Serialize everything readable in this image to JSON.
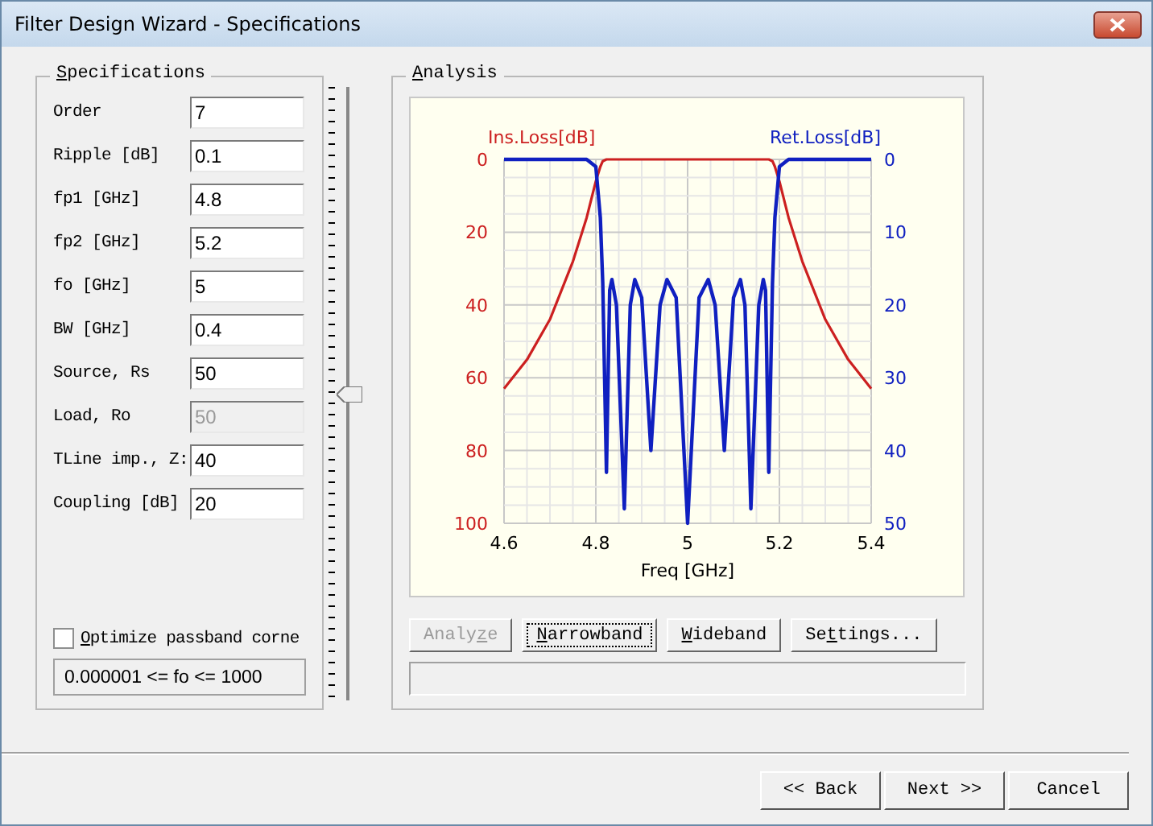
{
  "window": {
    "title": "Filter Design Wizard - Specifications"
  },
  "specifications": {
    "title": {
      "accel": "S",
      "rest": "pecifications"
    },
    "fields": [
      {
        "label": "Order",
        "value": "7",
        "disabled": false
      },
      {
        "label": "Ripple [dB]",
        "value": "0.1",
        "disabled": false
      },
      {
        "label": "fp1 [GHz]",
        "value": "4.8",
        "disabled": false
      },
      {
        "label": "fp2 [GHz]",
        "value": "5.2",
        "disabled": false
      },
      {
        "label": "fo [GHz]",
        "value": "5",
        "disabled": false
      },
      {
        "label": "BW [GHz]",
        "value": "0.4",
        "disabled": false
      },
      {
        "label": "Source, Rs",
        "value": "50",
        "disabled": false
      },
      {
        "label": "Load, Ro",
        "value": "50",
        "disabled": true
      },
      {
        "label": "TLine imp., Z:",
        "value": "40",
        "disabled": false
      },
      {
        "label": "Coupling [dB]",
        "value": "20",
        "disabled": false
      }
    ],
    "optimize": {
      "label": {
        "accel": "O",
        "rest": "ptimize passband corne"
      },
      "checked": false
    },
    "range_hint": "0.000001 <= fo <= 1000"
  },
  "trackbar": {
    "level": 0.5
  },
  "analysis": {
    "title": {
      "accel": "A",
      "rest": "nalysis"
    },
    "chart_data": {
      "type": "line",
      "xlabel": "Freq [GHz]",
      "x": [
        4.6,
        4.65,
        4.7,
        4.75,
        4.78,
        4.8,
        4.81,
        4.815,
        4.823,
        4.83,
        4.835,
        4.845,
        4.862,
        4.875,
        4.885,
        4.9,
        4.92,
        4.94,
        4.955,
        4.975,
        5.0,
        5.025,
        5.045,
        5.06,
        5.08,
        5.1,
        5.115,
        5.125,
        5.138,
        5.155,
        5.165,
        5.17,
        5.177,
        5.185,
        5.19,
        5.2,
        5.22,
        5.25,
        5.3,
        5.35,
        5.4
      ],
      "series": [
        {
          "name": "Ins.Loss[dB]",
          "color": "#cc2020",
          "values": [
            63,
            55,
            44,
            28,
            16,
            6,
            2,
            0.5,
            0,
            0,
            0,
            0,
            0,
            0,
            0,
            0,
            0,
            0,
            0,
            0,
            0,
            0,
            0,
            0,
            0,
            0,
            0,
            0,
            0,
            0,
            0,
            0,
            0,
            0.5,
            2,
            6,
            16,
            28,
            44,
            55,
            63
          ]
        },
        {
          "name": "Ret.Loss[dB]",
          "color": "#1020c0",
          "axis": "y2",
          "values": [
            0,
            0,
            0,
            0,
            0,
            1,
            8,
            17,
            43,
            18,
            16.5,
            20,
            48,
            20,
            16.5,
            19,
            40,
            20,
            16.5,
            19,
            50,
            19,
            16.5,
            20,
            40,
            19,
            16.5,
            20,
            48,
            20,
            16.5,
            18,
            43,
            17,
            8,
            1,
            0,
            0,
            0,
            0,
            0
          ]
        }
      ],
      "grid": true,
      "xlim": [
        4.6,
        5.4
      ],
      "ylim": [
        100,
        0
      ],
      "y2lim": [
        50,
        0
      ],
      "xticks": [
        4.6,
        4.8,
        5,
        5.2,
        5.4
      ],
      "yticks": [
        0,
        20,
        40,
        60,
        80,
        100
      ],
      "y2ticks": [
        0,
        10,
        20,
        30,
        40,
        50
      ]
    },
    "buttons": [
      {
        "label": {
          "lead": "Analy",
          "accel": "z",
          "rest": "e"
        },
        "disabled": true,
        "focused": false
      },
      {
        "label": {
          "accel": "N",
          "rest": "arrowband"
        },
        "disabled": false,
        "focused": true
      },
      {
        "label": {
          "accel": "W",
          "rest": "ideband"
        },
        "disabled": false,
        "focused": false
      },
      {
        "label": {
          "lead": "Se",
          "accel": "t",
          "rest": "tings..."
        },
        "disabled": false,
        "focused": false
      }
    ]
  },
  "footer_buttons": [
    {
      "label": "<< Back"
    },
    {
      "label": "Next >>"
    },
    {
      "label": "Cancel"
    }
  ]
}
